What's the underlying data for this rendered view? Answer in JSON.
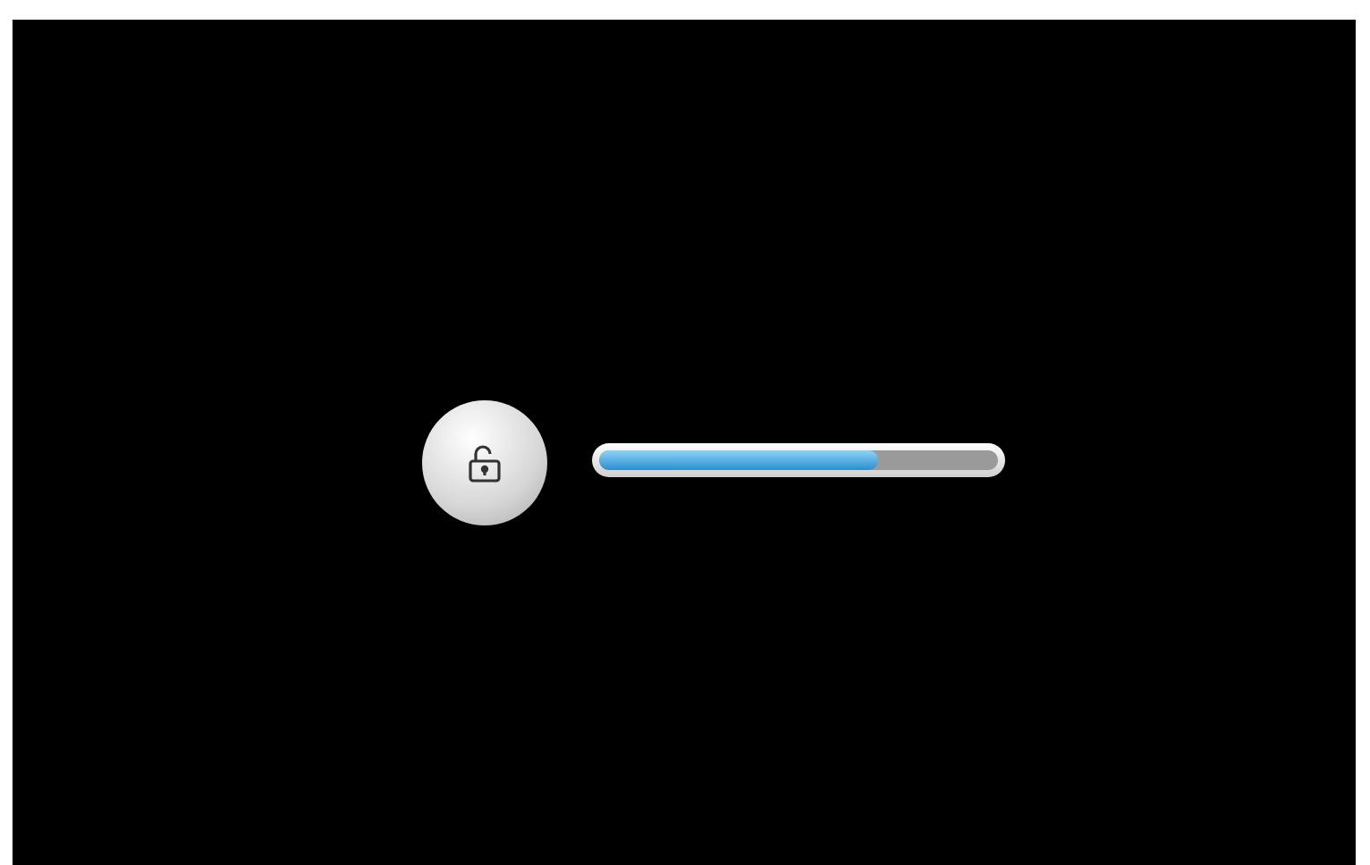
{
  "unlock_progress": {
    "level": 0.7
  }
}
